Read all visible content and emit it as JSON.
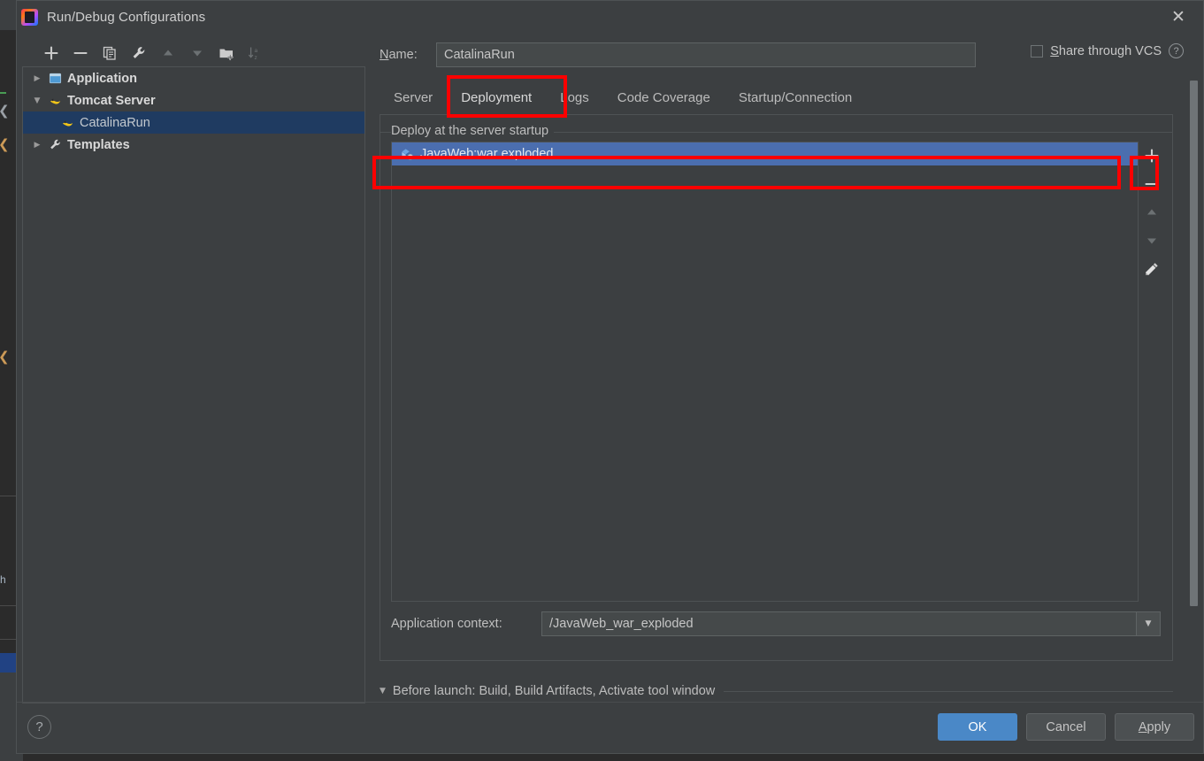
{
  "window": {
    "title": "Run/Debug Configurations",
    "app_icon": "intellij-idea-icon",
    "close_icon": "close-icon"
  },
  "tree_toolbar": {
    "buttons": [
      {
        "name": "add-configuration-button",
        "icon": "plus-icon",
        "enabled": true
      },
      {
        "name": "remove-configuration-button",
        "icon": "minus-icon",
        "enabled": true
      },
      {
        "name": "copy-configuration-button",
        "icon": "copy-icon",
        "enabled": true
      },
      {
        "name": "edit-templates-button",
        "icon": "wrench-icon",
        "enabled": true
      },
      {
        "name": "move-up-button",
        "icon": "arrow-up-icon",
        "enabled": false
      },
      {
        "name": "move-down-button",
        "icon": "arrow-down-icon",
        "enabled": false
      },
      {
        "name": "new-folder-button",
        "icon": "folder-add-icon",
        "enabled": true
      },
      {
        "name": "sort-configurations-button",
        "icon": "sort-az-icon",
        "enabled": false
      }
    ]
  },
  "tree": {
    "items": [
      {
        "label": "Application",
        "icon": "application-icon",
        "twisty": "▶",
        "level": 0,
        "bold": true,
        "selected": false
      },
      {
        "label": "Tomcat Server",
        "icon": "tomcat-icon",
        "twisty": "▼",
        "level": 0,
        "bold": true,
        "selected": false
      },
      {
        "label": "CatalinaRun",
        "icon": "tomcat-icon",
        "twisty": "",
        "level": 1,
        "bold": false,
        "selected": true
      },
      {
        "label": "Templates",
        "icon": "wrench-icon",
        "twisty": "▶",
        "level": 0,
        "bold": true,
        "selected": false
      }
    ]
  },
  "name_field": {
    "label_prefix": "N",
    "label_rest": "ame:",
    "value": "CatalinaRun",
    "placeholder": "Name"
  },
  "share_vcs": {
    "label_prefix": "S",
    "label_rest": "hare through VCS",
    "checked": false,
    "help_icon": "question-mark-icon",
    "help_glyph": "?"
  },
  "tabs": [
    {
      "label": "Server",
      "active": false
    },
    {
      "label": "Deployment",
      "active": true
    },
    {
      "label": "Logs",
      "active": false
    },
    {
      "label": "Code Coverage",
      "active": false
    },
    {
      "label": "Startup/Connection",
      "active": false
    }
  ],
  "deployment": {
    "legend": "Deploy at the server startup",
    "artifacts": [
      {
        "label": "JavaWeb:war exploded",
        "icon": "artifact-icon",
        "selected": true
      }
    ],
    "list_toolbar": [
      {
        "name": "add-artifact-button",
        "icon": "plus-icon",
        "enabled": true,
        "highlighted": true
      },
      {
        "name": "remove-artifact-button",
        "icon": "minus-icon",
        "enabled": true,
        "highlighted": false
      },
      {
        "name": "move-artifact-up",
        "icon": "arrow-up-icon",
        "enabled": false,
        "highlighted": false
      },
      {
        "name": "move-artifact-down",
        "icon": "arrow-down-icon",
        "enabled": false,
        "highlighted": false
      },
      {
        "name": "edit-artifact-button",
        "icon": "pencil-icon",
        "enabled": true,
        "highlighted": false
      }
    ],
    "app_context": {
      "label": "Application context:",
      "value": "/JavaWeb_war_exploded",
      "dropdown_icon": "chevron-down-icon",
      "dropdown_glyph": "▼"
    }
  },
  "before_launch": {
    "twisty_glyph": "▼",
    "text": "Before launch: Build, Build Artifacts, Activate tool window"
  },
  "footer": {
    "help_glyph": "?",
    "help_icon": "question-mark-icon",
    "ok": "OK",
    "cancel": "Cancel",
    "apply_prefix": "A",
    "apply_rest": "pply"
  },
  "colors": {
    "window_bg": "#3c3f41",
    "editor_bg": "#2b2b2b",
    "selection_blue": "#4b6eaf",
    "tree_selection": "#1f3b61",
    "accent_button": "#4a88c7",
    "annotation_red": "#fe0000",
    "text": "#bbbbbb"
  },
  "annotations": [
    {
      "name": "annotation-box-deployment-tab",
      "target": "Deployment tab"
    },
    {
      "name": "annotation-box-artifact-row",
      "target": "JavaWeb:war exploded"
    },
    {
      "name": "annotation-box-add-artifact",
      "target": "add artifact plus button"
    }
  ]
}
